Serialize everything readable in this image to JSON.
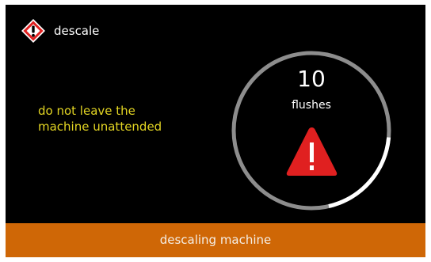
{
  "header": {
    "icon": "hazard-diamond-icon",
    "title": "descale"
  },
  "warning": {
    "line1": "do not leave the",
    "line2": "machine unattended",
    "color": "#e3d523"
  },
  "progress": {
    "count": "10",
    "unit_label": "flushes",
    "fraction_complete": 0.2,
    "alert_icon": "warning-triangle-icon",
    "alert_color": "#e02020"
  },
  "footer": {
    "status_label": "descaling machine",
    "color": "#cf6706"
  }
}
